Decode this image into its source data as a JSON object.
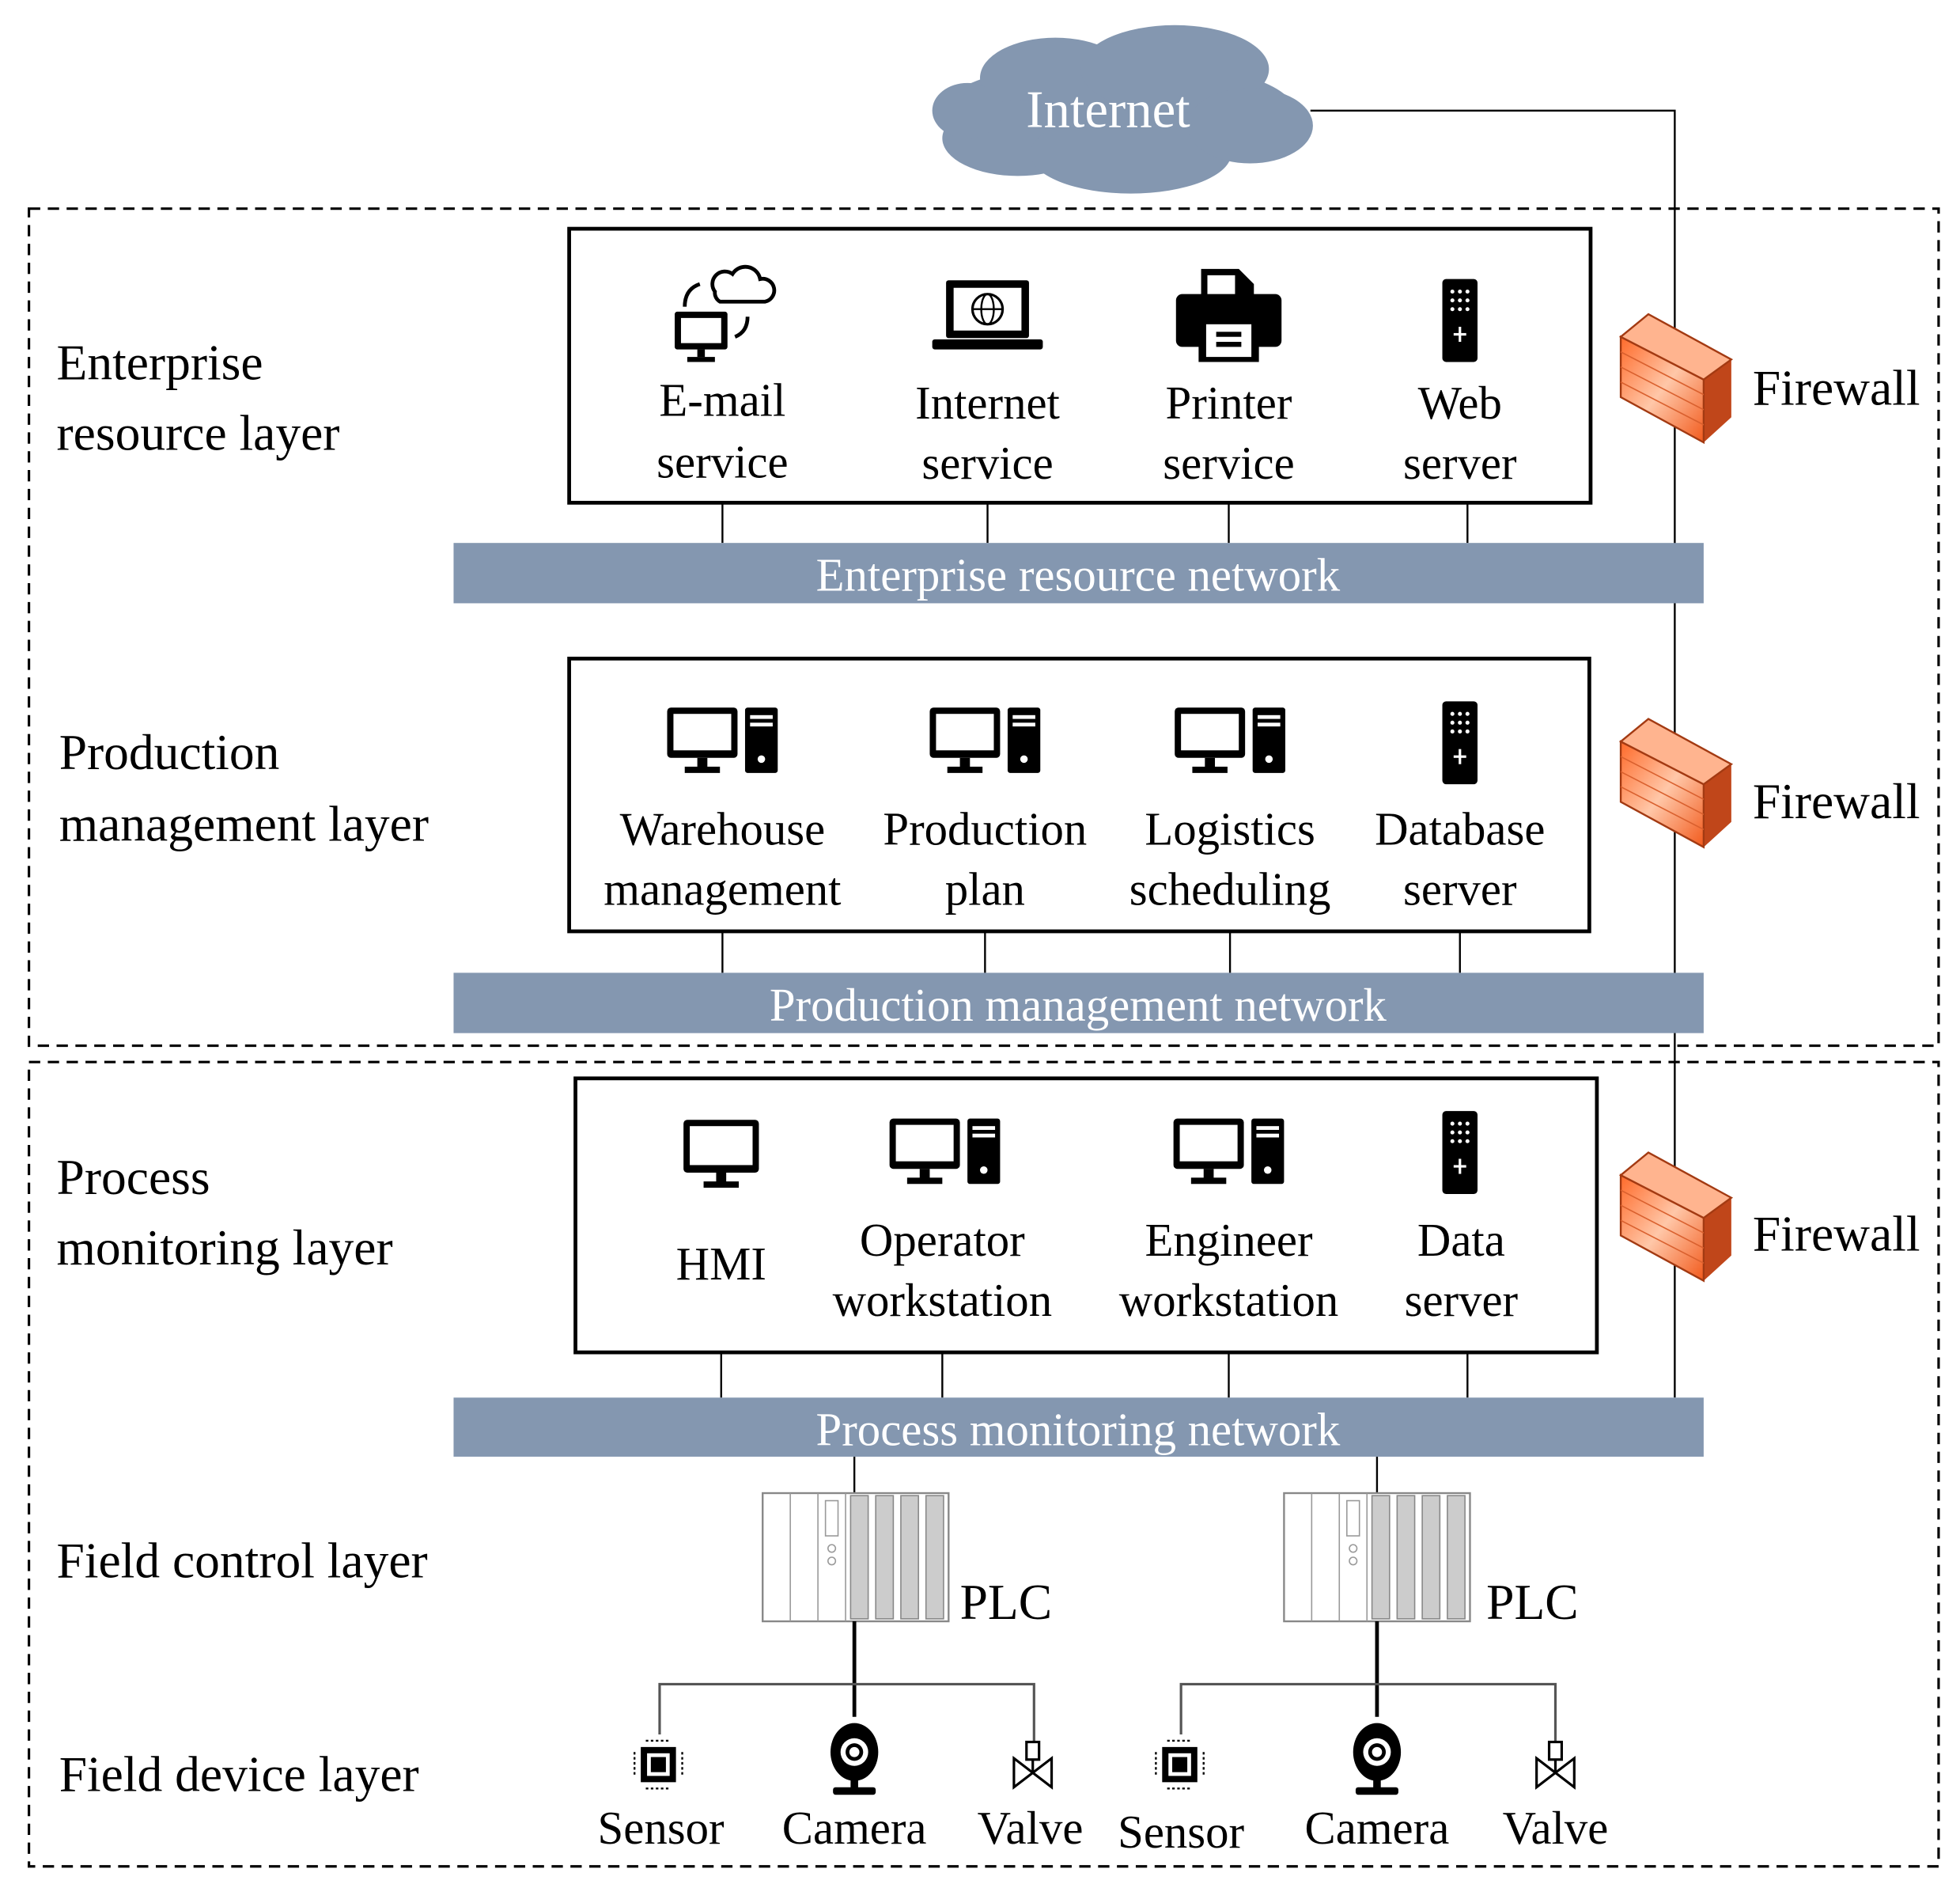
{
  "colors": {
    "network_bar": "#8497b0",
    "cloud": "#8497b0",
    "firewall": "#f4703a"
  },
  "internet": "Internet",
  "layers": {
    "enterprise": [
      "Enterprise",
      "resource layer"
    ],
    "production": [
      "Production",
      "management layer"
    ],
    "process": [
      "Process",
      "monitoring layer"
    ],
    "field_control": "Field control layer",
    "field_device": "Field device layer"
  },
  "enterprise_items": [
    {
      "icon": "cloud-sync-computer-icon",
      "lines": [
        "E-mail",
        "service"
      ]
    },
    {
      "icon": "laptop-globe-icon",
      "lines": [
        "Internet",
        "service"
      ]
    },
    {
      "icon": "printer-icon",
      "lines": [
        "Printer",
        "service"
      ]
    },
    {
      "icon": "server-icon",
      "lines": [
        "Web",
        "server"
      ]
    }
  ],
  "production_items": [
    {
      "icon": "desktop-computer-icon",
      "lines": [
        "Warehouse",
        "management"
      ]
    },
    {
      "icon": "desktop-computer-icon",
      "lines": [
        "Production",
        "plan"
      ]
    },
    {
      "icon": "desktop-computer-icon",
      "lines": [
        "Logistics",
        "scheduling"
      ]
    },
    {
      "icon": "server-icon",
      "lines": [
        "Database",
        "server"
      ]
    }
  ],
  "process_items": [
    {
      "icon": "monitor-icon",
      "lines": [
        "HMI"
      ]
    },
    {
      "icon": "desktop-computer-icon",
      "lines": [
        "Operator",
        "workstation"
      ]
    },
    {
      "icon": "desktop-computer-icon",
      "lines": [
        "Engineer",
        "workstation"
      ]
    },
    {
      "icon": "server-icon",
      "lines": [
        "Data",
        "server"
      ]
    }
  ],
  "networks": {
    "enterprise": "Enterprise resource network",
    "production": "Production management network",
    "process": "Process monitoring network"
  },
  "firewall_label": "Firewall",
  "plc_label": "PLC",
  "devices": [
    "Sensor",
    "Camera",
    "Valve",
    "Sensor",
    "Camera",
    "Valve"
  ]
}
